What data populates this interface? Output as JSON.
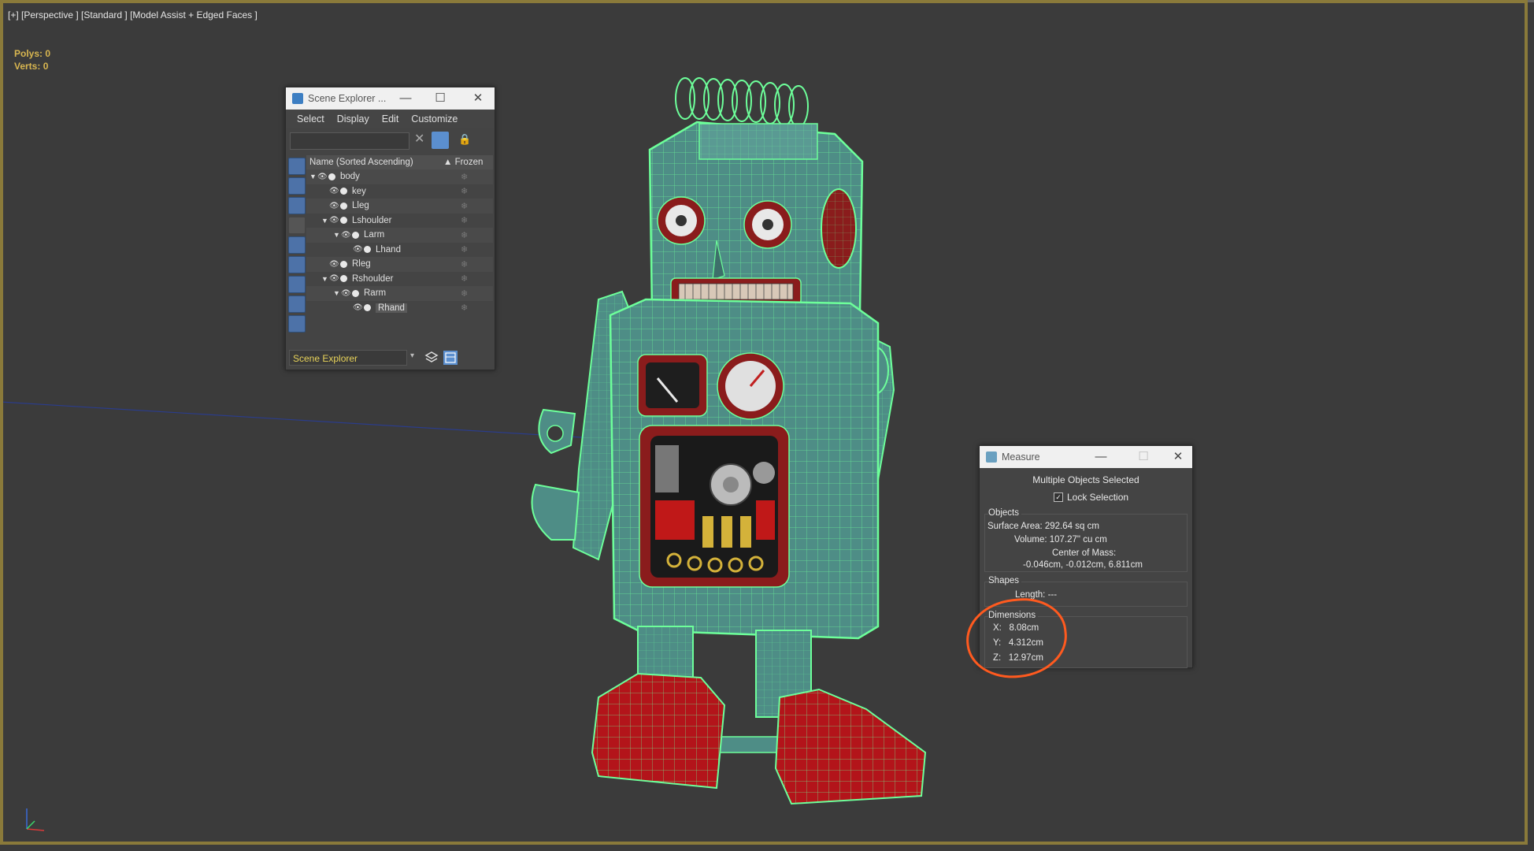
{
  "viewport": {
    "label": "[+] [Perspective ] [Standard ] [Model Assist + Edged Faces ]",
    "stats": [
      {
        "label": "Polys:",
        "value": "0"
      },
      {
        "label": "Verts:",
        "value": "0"
      }
    ]
  },
  "scene_explorer": {
    "title": "Scene Explorer ...",
    "menu": [
      "Select",
      "Display",
      "Edit",
      "Customize"
    ],
    "columns": {
      "name": "Name (Sorted Ascending)",
      "frozen": "▲ Frozen"
    },
    "rows": [
      {
        "name": "body",
        "depth": 0,
        "expanded": true
      },
      {
        "name": "key",
        "depth": 1,
        "expanded": false
      },
      {
        "name": "Lleg",
        "depth": 1,
        "expanded": false
      },
      {
        "name": "Lshoulder",
        "depth": 1,
        "expanded": true
      },
      {
        "name": "Larm",
        "depth": 2,
        "expanded": true
      },
      {
        "name": "Lhand",
        "depth": 3,
        "expanded": false
      },
      {
        "name": "Rleg",
        "depth": 1,
        "expanded": false
      },
      {
        "name": "Rshoulder",
        "depth": 1,
        "expanded": true
      },
      {
        "name": "Rarm",
        "depth": 2,
        "expanded": true
      },
      {
        "name": "Rhand",
        "depth": 3,
        "expanded": false,
        "selected": true
      }
    ],
    "bottom_dropdown": "Scene Explorer"
  },
  "measure": {
    "title": "Measure",
    "header": "Multiple Objects Selected",
    "lock_selection": "Lock Selection",
    "objects_title": "Objects",
    "surface_area": "Surface Area: 292.64 sq cm",
    "volume": "Volume: 107.27\" cu cm",
    "center_of_mass_label": "Center of Mass:",
    "center_of_mass": "-0.046cm, -0.012cm, 6.811cm",
    "shapes_title": "Shapes",
    "length": "Length: ---",
    "dimensions_title": "Dimensions",
    "x": "X:   8.08cm",
    "y": "Y:   4.312cm",
    "z": "Z:   12.97cm"
  },
  "colors": {
    "wire": "#6dff9a",
    "body": "#4e8d86",
    "feet": "#b3141a",
    "highlight": "#ff5a1f",
    "frame": "#8a7a3a"
  }
}
